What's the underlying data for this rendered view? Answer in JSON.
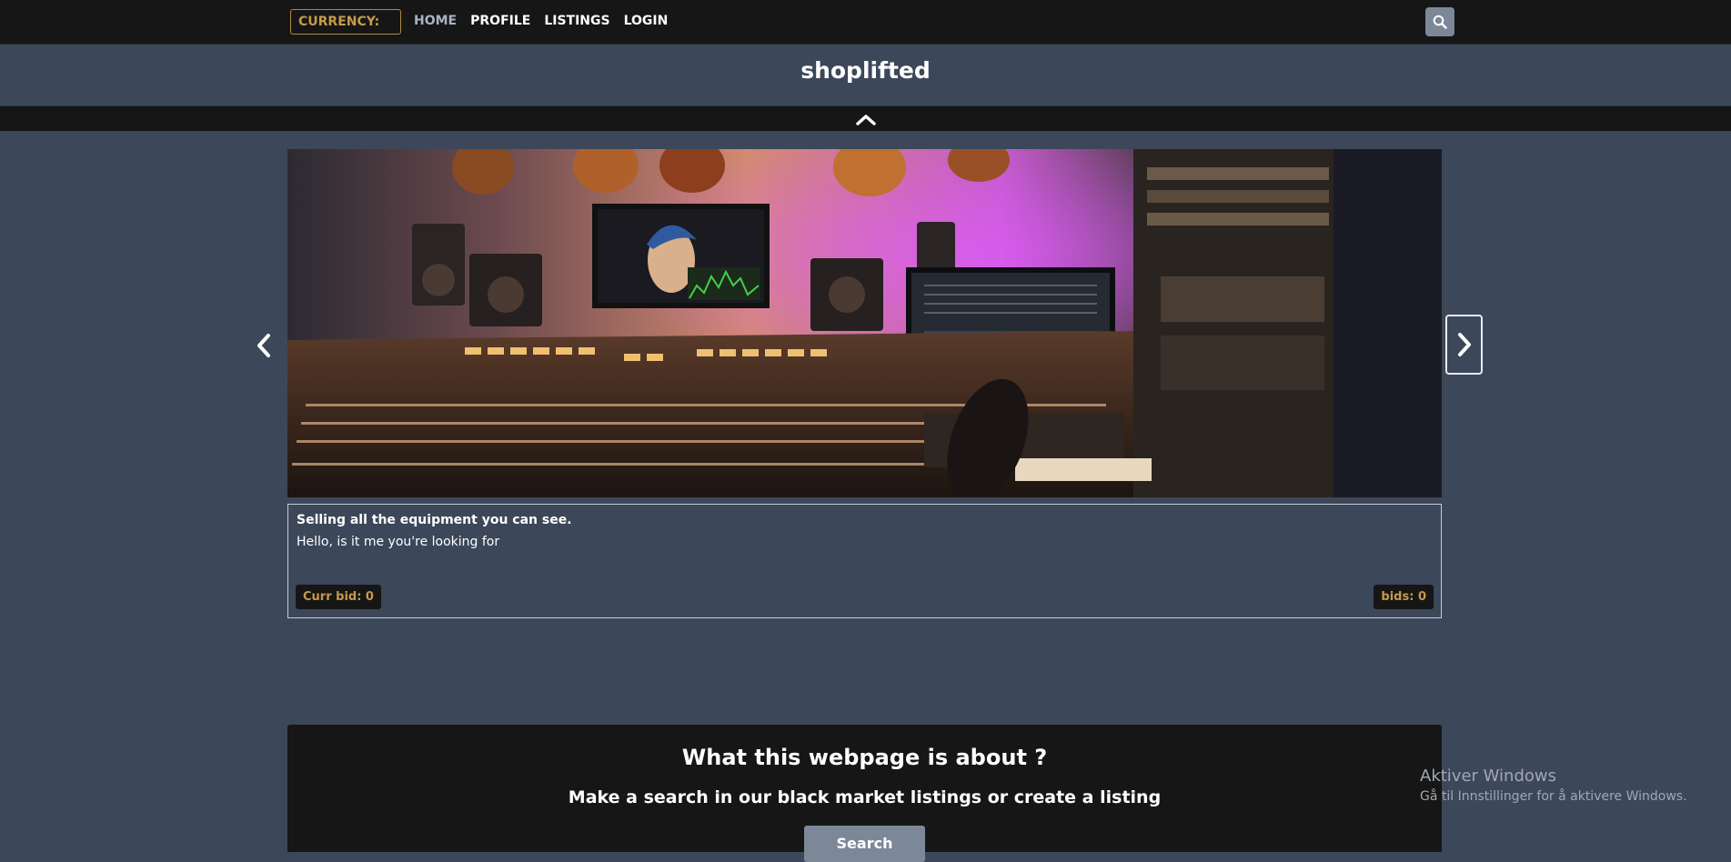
{
  "nav": {
    "currency_label": "CURRENCY:",
    "links": [
      "HOME",
      "PROFILE",
      "LISTINGS",
      "LOGIN"
    ]
  },
  "header": {
    "title": "shoplifted"
  },
  "listing": {
    "title": "Selling all the equipment you can see.",
    "description": "Hello, is it me you're looking for",
    "curr_bid": "Curr bid: 0",
    "bids": "bids: 0"
  },
  "about": {
    "heading": "What this webpage is about ?",
    "subheading": "Make a search in our black market listings or create a listing",
    "search_label": "Search"
  },
  "watermark": {
    "line1": "Aktiver Windows",
    "line2": "Gå til Innstillinger for å aktivere Windows."
  },
  "colors": {
    "accent": "#c79a4a",
    "dark": "#161616",
    "page_bg": "#3c4759",
    "button": "#7c8798"
  }
}
